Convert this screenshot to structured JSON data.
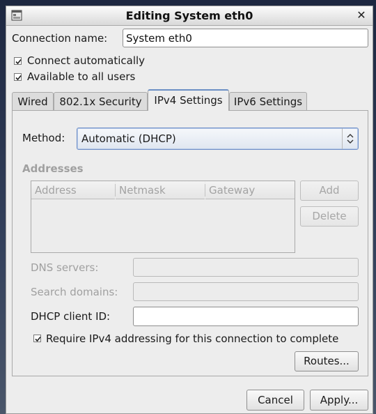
{
  "window": {
    "title": "Editing System eth0",
    "close_icon": "close-icon"
  },
  "connection_name": {
    "label": "Connection name:",
    "value": "System eth0"
  },
  "options": {
    "connect_automatically": {
      "label": "Connect automatically",
      "checked": true
    },
    "available_to_all": {
      "label": "Available to all users",
      "checked": true
    }
  },
  "tabs": [
    {
      "label": "Wired"
    },
    {
      "label": "802.1x Security"
    },
    {
      "label": "IPv4 Settings",
      "active": true
    },
    {
      "label": "IPv6 Settings"
    }
  ],
  "ipv4": {
    "method_label": "Method:",
    "method_value": "Automatic (DHCP)",
    "addresses_header": "Addresses",
    "columns": [
      "Address",
      "Netmask",
      "Gateway"
    ],
    "add_button": "Add",
    "delete_button": "Delete",
    "dns_label": "DNS servers:",
    "dns_value": "",
    "search_label": "Search domains:",
    "search_value": "",
    "dhcp_label": "DHCP client ID:",
    "dhcp_value": "",
    "require_ipv4": {
      "label": "Require IPv4 addressing for this connection to complete",
      "checked": true
    },
    "routes_button": "Routes..."
  },
  "footer": {
    "cancel_button": "Cancel",
    "apply_button": "Apply..."
  },
  "colors": {
    "accent": "#6b8fc4",
    "background": "#ededed",
    "disabled_text": "#a0a0a0"
  }
}
